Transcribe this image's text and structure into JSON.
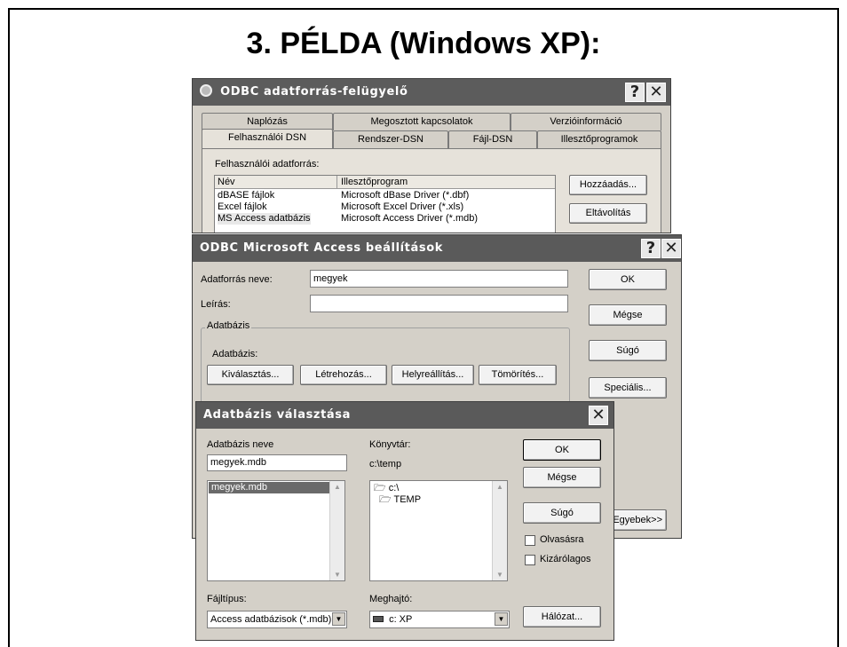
{
  "slide": {
    "title": "3. PÉLDA  (Windows XP):"
  },
  "odbc_admin": {
    "title": "ODBC adatforrás-felügyelő",
    "help_btn": "?",
    "close_btn": "✕",
    "tabs_back": [
      "Naplózás",
      "Megosztott kapcsolatok",
      "Verzióinformáció"
    ],
    "tabs_front": [
      "Felhasználói DSN",
      "Rendszer-DSN",
      "Fájl-DSN",
      "Illesztőprogramok"
    ],
    "user_ds_label": "Felhasználói adatforrás:",
    "columns": [
      "Név",
      "Illesztőprogram"
    ],
    "rows": [
      {
        "name": "dBASE fájlok",
        "driver": "Microsoft dBase Driver (*.dbf)"
      },
      {
        "name": "Excel fájlok",
        "driver": "Microsoft Excel Driver (*.xls)"
      },
      {
        "name": "MS Access adatbázis",
        "driver": "Microsoft Access Driver (*.mdb)"
      }
    ],
    "add_btn": "Hozzáadás...",
    "remove_btn": "Eltávolítás"
  },
  "access_setup": {
    "title": "ODBC Microsoft Access beállítások",
    "help_btn": "?",
    "close_btn": "✕",
    "ds_name_label": "Adatforrás neve:",
    "ds_name_value": "megyek",
    "desc_label": "Leírás:",
    "desc_value": "",
    "group_caption": "Adatbázis",
    "db_label": "Adatbázis:",
    "select_btn": "Kiválasztás...",
    "create_btn": "Létrehozás...",
    "repair_btn": "Helyreállítás...",
    "compact_btn": "Tömörítés...",
    "ok_btn": "OK",
    "cancel_btn": "Mégse",
    "help_text_btn": "Súgó",
    "advanced_btn": "Speciális...",
    "options_btn": "Egyebek>>"
  },
  "select_db": {
    "title": "Adatbázis választása",
    "close_btn": "✕",
    "db_name_label": "Adatbázis neve",
    "db_name_value": "megyek.mdb",
    "file_list": [
      "megyek.mdb"
    ],
    "dir_label": "Könyvtár:",
    "dir_value": "c:\\temp",
    "dir_list": [
      "c:\\",
      "TEMP"
    ],
    "file_type_label": "Fájltípus:",
    "file_type_value": "Access adatbázisok (*.mdb)",
    "drive_label": "Meghajtó:",
    "drive_value": "c: XP",
    "ok_btn": "OK",
    "cancel_btn": "Mégse",
    "help_btn": "Súgó",
    "network_btn": "Hálózat...",
    "readonly_label": "Olvasásra",
    "exclusive_label": "Kizárólagos"
  }
}
